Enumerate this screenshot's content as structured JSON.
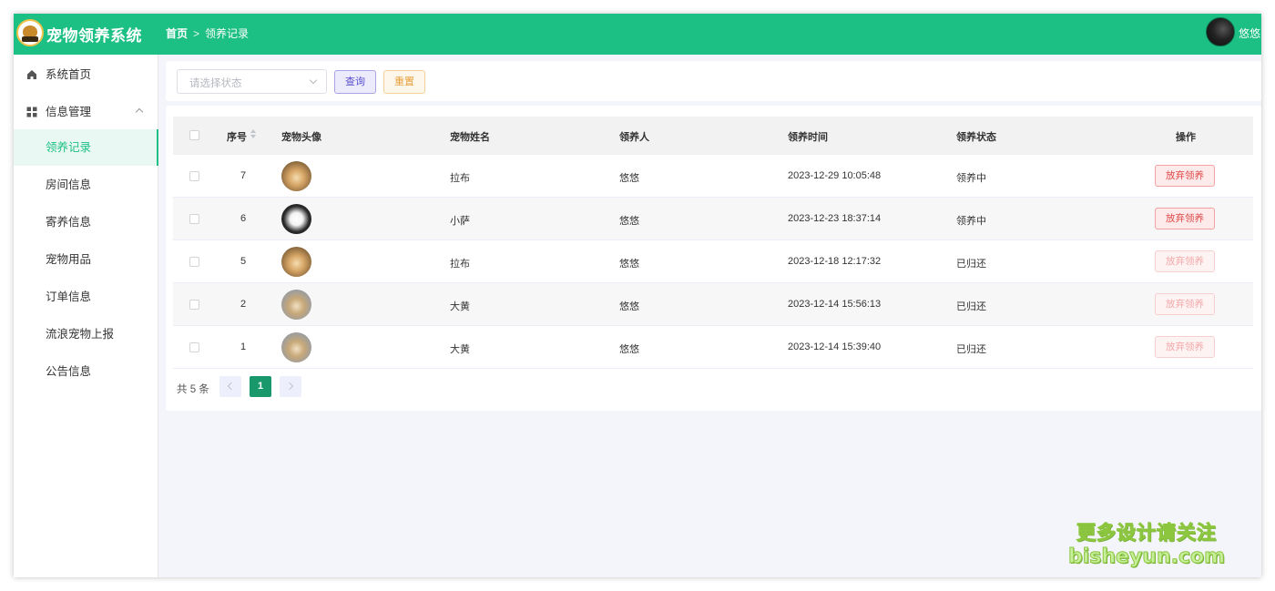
{
  "header": {
    "app_title": "宠物领养系统",
    "breadcrumb_home": "首页",
    "breadcrumb_sep": ">",
    "breadcrumb_current": "领养记录",
    "user_name": "悠悠",
    "brand_color": "#1cbf84"
  },
  "sidebar": {
    "items": [
      {
        "label": "系统首页",
        "icon": "home-icon"
      },
      {
        "label": "信息管理",
        "icon": "grid-icon",
        "expanded": true
      },
      {
        "label": "领养记录",
        "active": true
      },
      {
        "label": "房间信息"
      },
      {
        "label": "寄养信息"
      },
      {
        "label": "宠物用品"
      },
      {
        "label": "订单信息"
      },
      {
        "label": "流浪宠物上报"
      },
      {
        "label": "公告信息"
      }
    ]
  },
  "search": {
    "status_placeholder": "请选择状态",
    "query_label": "查询",
    "reset_label": "重置"
  },
  "table": {
    "columns": [
      "序号",
      "宠物头像",
      "宠物姓名",
      "领养人",
      "领养时间",
      "领养状态",
      "操作"
    ],
    "rows": [
      {
        "no": "7",
        "avatar": "golden",
        "pet_name": "拉布",
        "adopter": "悠悠",
        "time": "2023-12-29 10:05:48",
        "status": "领养中",
        "action": "放弃领养",
        "action_enabled": true
      },
      {
        "no": "6",
        "avatar": "white",
        "pet_name": "小萨",
        "adopter": "悠悠",
        "time": "2023-12-23 18:37:14",
        "status": "领养中",
        "action": "放弃领养",
        "action_enabled": true
      },
      {
        "no": "5",
        "avatar": "golden",
        "pet_name": "拉布",
        "adopter": "悠悠",
        "time": "2023-12-18 12:17:32",
        "status": "已归还",
        "action": "放弃领养",
        "action_enabled": false
      },
      {
        "no": "2",
        "avatar": "pale",
        "pet_name": "大黄",
        "adopter": "悠悠",
        "time": "2023-12-14 15:56:13",
        "status": "已归还",
        "action": "放弃领养",
        "action_enabled": false
      },
      {
        "no": "1",
        "avatar": "pale",
        "pet_name": "大黄",
        "adopter": "悠悠",
        "time": "2023-12-14 15:39:40",
        "status": "已归还",
        "action": "放弃领养",
        "action_enabled": false
      }
    ]
  },
  "pagination": {
    "total_text": "共 5 条",
    "current_page": "1"
  },
  "watermark": {
    "line1": "更多设计请关注",
    "line2": "bisheyun.com"
  }
}
